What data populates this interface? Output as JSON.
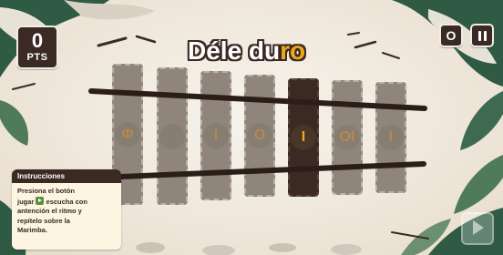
{
  "score": {
    "value": "0",
    "unit": "PTS"
  },
  "title": {
    "part1": "Déle du",
    "part2": "ro"
  },
  "top_buttons": {
    "o_label": "O"
  },
  "bars": [
    {
      "symbol": "Φ",
      "active": false
    },
    {
      "symbol": "",
      "active": false
    },
    {
      "symbol": "I",
      "active": false
    },
    {
      "symbol": "O",
      "active": false
    },
    {
      "symbol": "I",
      "active": true
    },
    {
      "symbol": "OI",
      "active": false
    },
    {
      "symbol": "I",
      "active": false
    }
  ],
  "instructions": {
    "heading": "Instrucciones",
    "line1": "Presiona el botón",
    "line2a": "jugar",
    "line2b": "escucha con",
    "line3": "antención el ritmo y",
    "line4": "repítelo sobre la",
    "line5": "Marimba."
  },
  "colors": {
    "dark_brown": "#3b2a23",
    "bar_gray": "#8f857b",
    "accent_orange": "#f0a81a",
    "leaf_green": "#4f7a5b",
    "paper": "#f2ede4"
  },
  "icons": {
    "pause": "pause-icon",
    "play": "play-icon"
  }
}
